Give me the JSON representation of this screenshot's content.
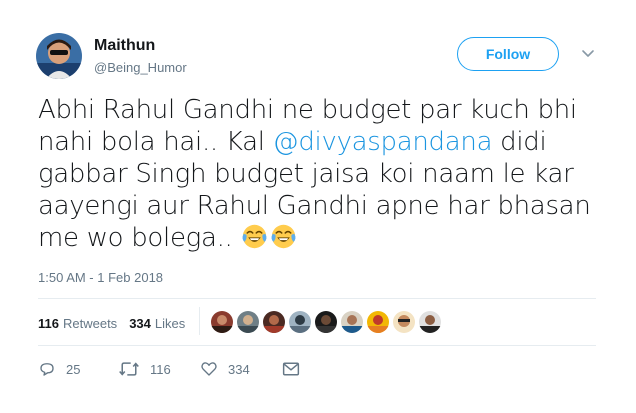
{
  "author": {
    "name": "Maithun",
    "handle": "@Being_Humor",
    "avatar_icon": "avatar-icon"
  },
  "follow_label": "Follow",
  "tweet": {
    "text_before": "Abhi Rahul Gandhi ne budget par kuch bhi nahi bola hai.. Kal ",
    "mention": "@divyaspandana",
    "text_after": " didi gabbar Singh budget jaisa koi naam le kar aayengi aur Rahul Gandhi apne har bhasan me wo bolega.. ",
    "emojis": [
      "face-with-tears-of-joy-icon",
      "face-with-tears-of-joy-icon"
    ]
  },
  "timestamp": "1:50 AM - 1 Feb 2018",
  "stats": {
    "retweets_count": "116",
    "retweets_label": "Retweets",
    "likes_count": "334",
    "likes_label": "Likes"
  },
  "actions": {
    "reply_count": "25",
    "retweet_count": "116",
    "like_count": "334"
  },
  "colors": {
    "accent": "#1da1f2",
    "mention": "#1b95e0",
    "secondary_text": "#657786",
    "divider": "#e6ecf0"
  }
}
